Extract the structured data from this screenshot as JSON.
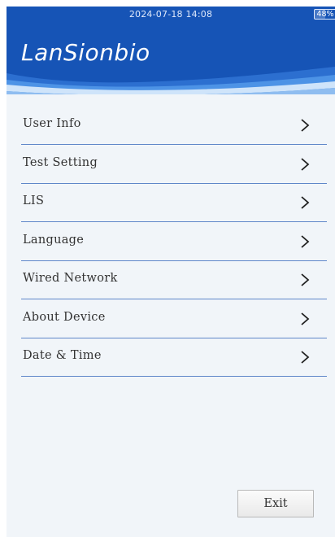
{
  "status_bar": {
    "datetime": "2024-07-18  14:08",
    "battery": "48%",
    "battery_level": 0.48
  },
  "header": {
    "logo_text": "LanSionbio"
  },
  "menu": {
    "items": [
      {
        "label": "User Info"
      },
      {
        "label": "Test Setting"
      },
      {
        "label": "LIS"
      },
      {
        "label": "Language"
      },
      {
        "label": "Wired Network"
      },
      {
        "label": "About Device"
      },
      {
        "label": "Date & Time"
      }
    ]
  },
  "footer": {
    "exit_label": "Exit"
  },
  "colors": {
    "header_blue": "#1654b6",
    "divider_blue": "#5f87c9",
    "background": "#f1f5f9"
  }
}
